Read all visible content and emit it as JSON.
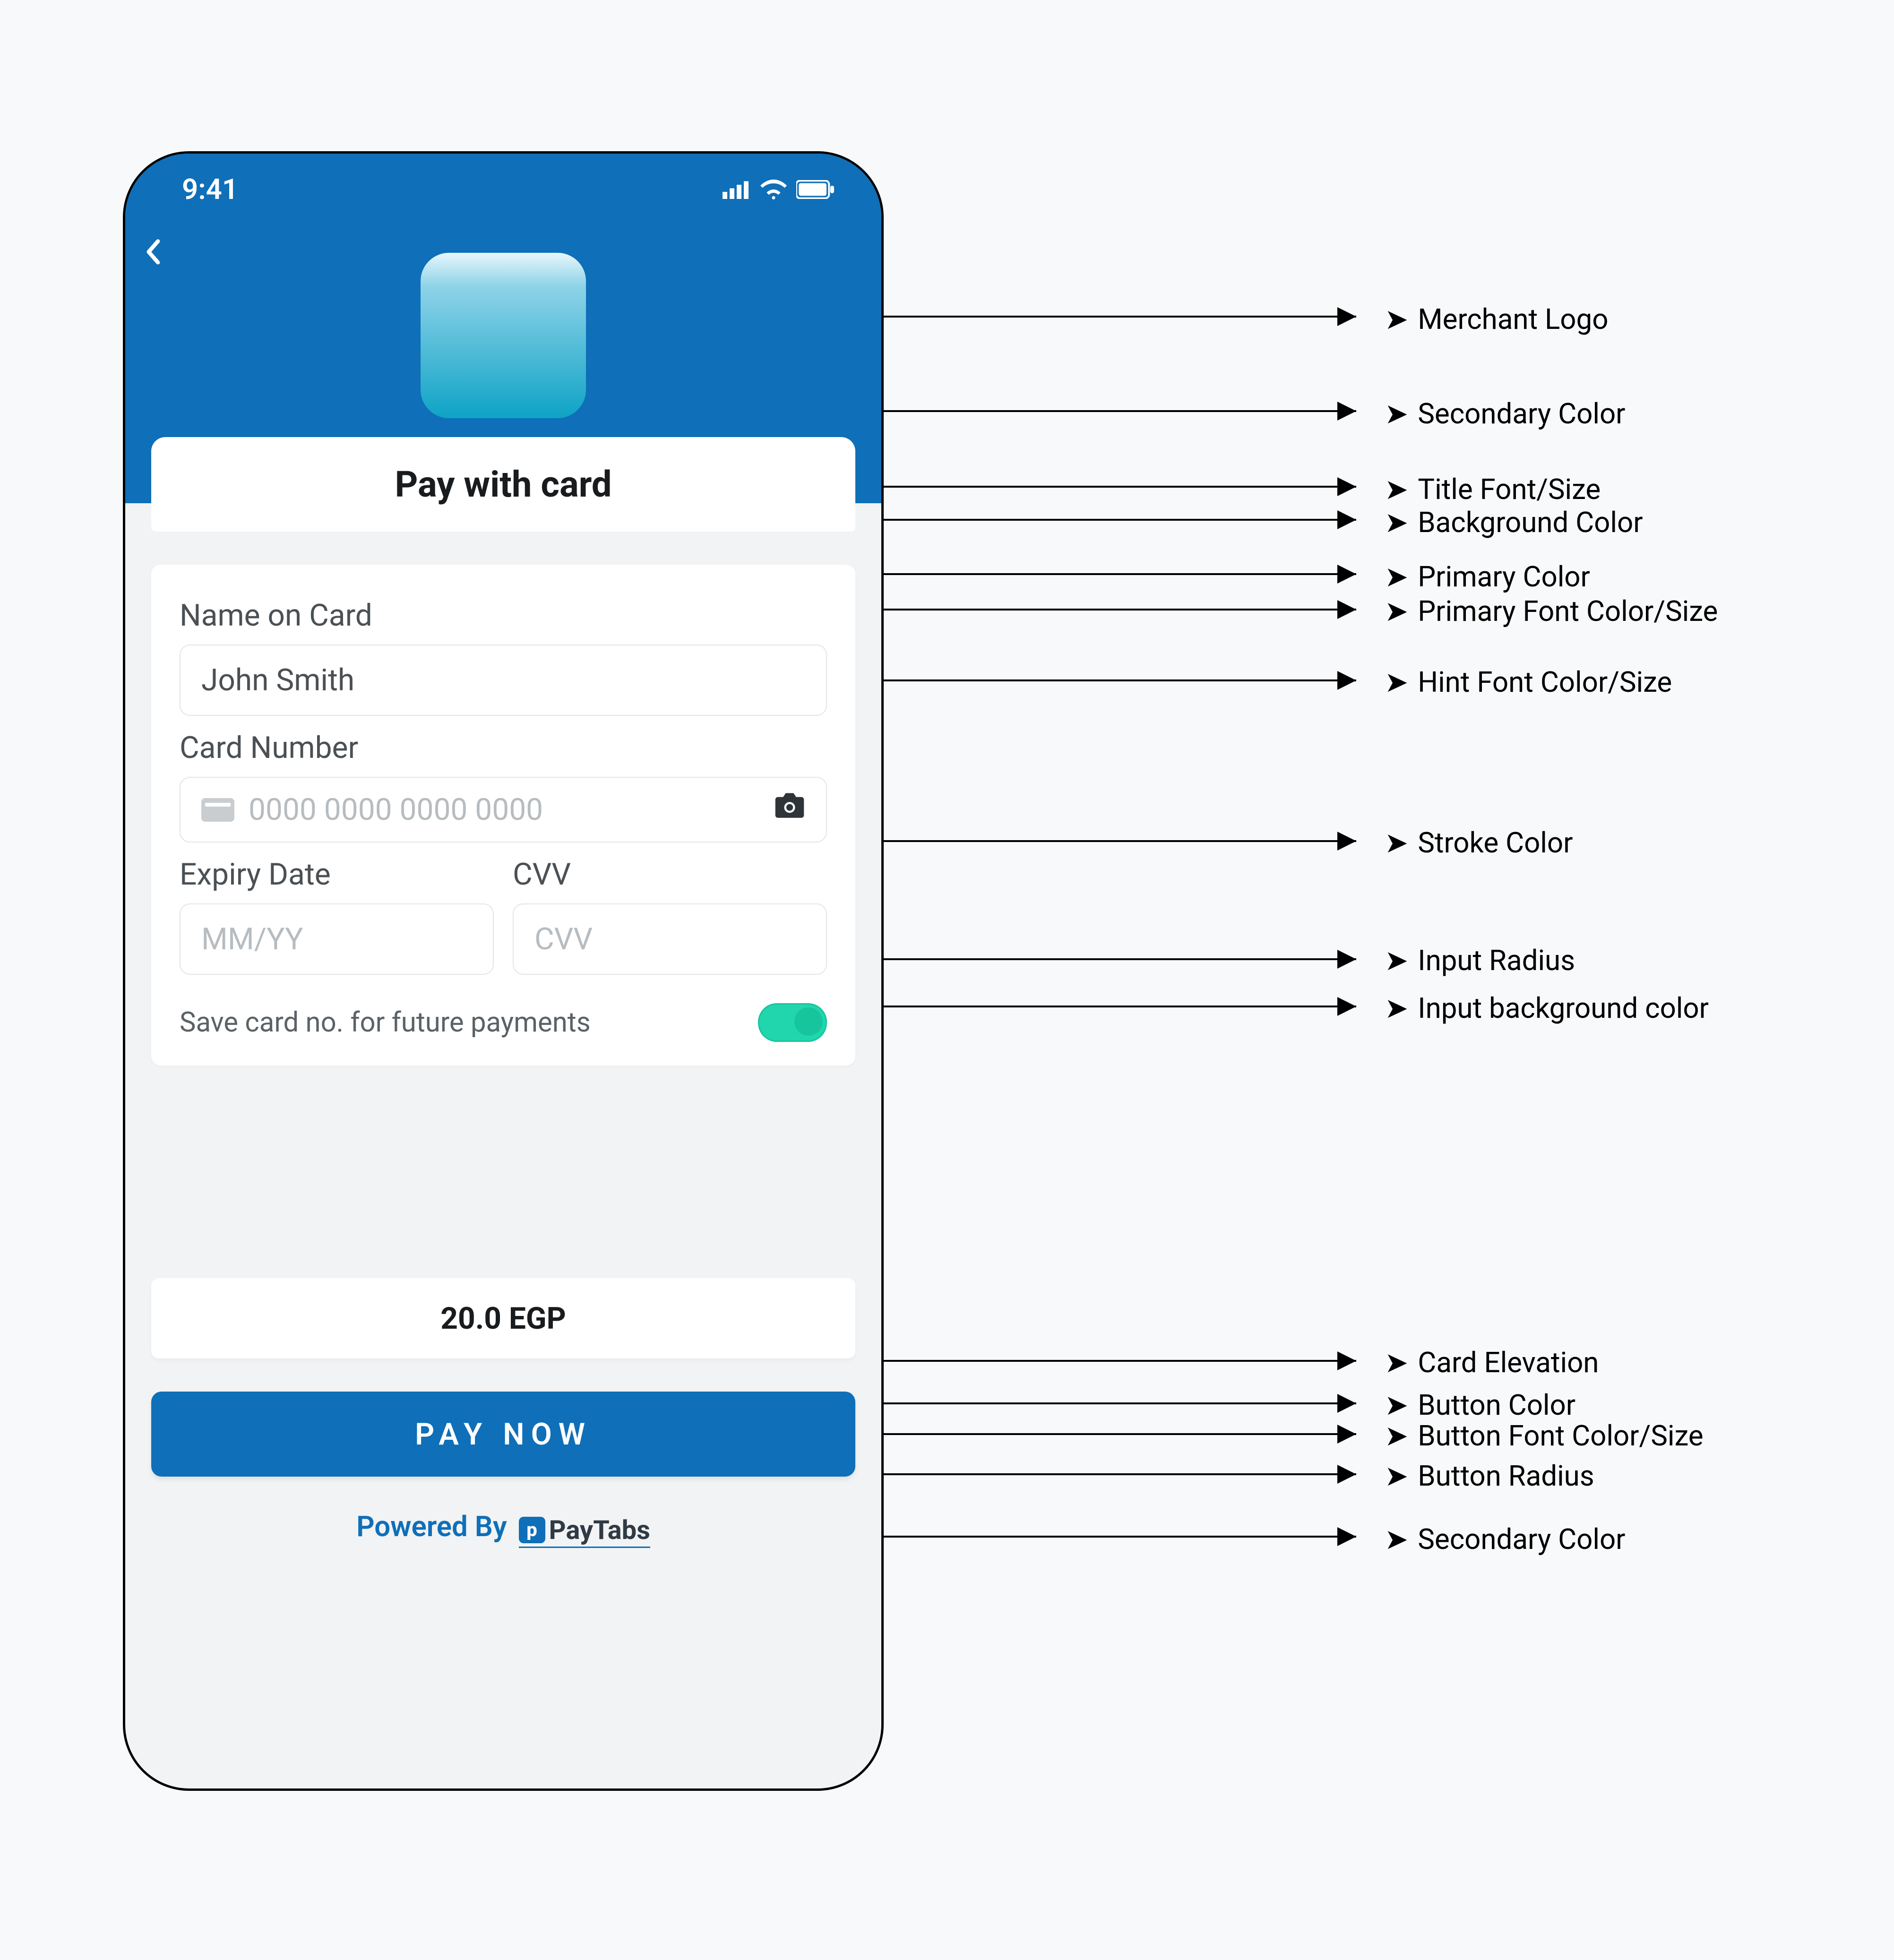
{
  "status": {
    "time": "9:41"
  },
  "title": "Pay with card",
  "form": {
    "name_label": "Name on Card",
    "name_value": "John Smith",
    "card_label": "Card Number",
    "card_placeholder": "0000 0000 0000 0000",
    "expiry_label": "Expiry Date",
    "expiry_placeholder": "MM/YY",
    "cvv_label": "CVV",
    "cvv_placeholder": "CVV",
    "save_label": "Save card no. for future payments"
  },
  "amount": "20.0 EGP",
  "button": "PAY NOW",
  "powered": {
    "prefix": "Powered By",
    "brand": "PayTabs"
  },
  "annotations": {
    "merchant_logo": "Merchant Logo",
    "secondary_color_1": "Secondary Color",
    "title_font": "Title Font/Size",
    "background_color": "Background Color",
    "primary_color": "Primary Color",
    "primary_font": "Primary Font Color/Size",
    "hint_font": "Hint Font Color/Size",
    "stroke_color": "Stroke Color",
    "input_radius": "Input Radius",
    "input_bg": "Input background color",
    "card_elevation": "Card Elevation",
    "button_color": "Button Color",
    "button_font": "Button Font Color/Size",
    "button_radius": "Button Radius",
    "secondary_color_2": "Secondary Color"
  }
}
